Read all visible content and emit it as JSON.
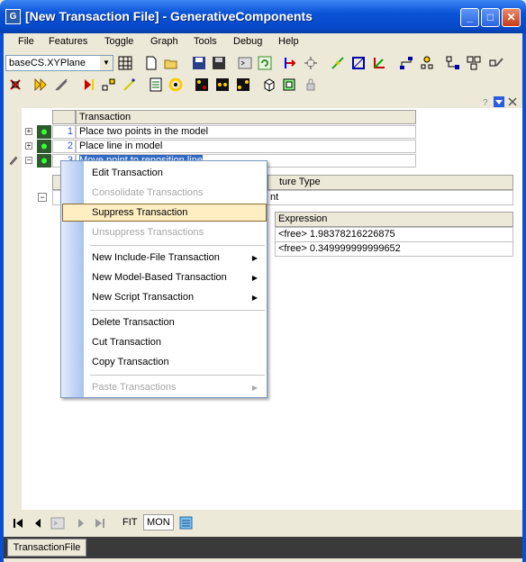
{
  "window": {
    "title": "[New Transaction File] - GenerativeComponents"
  },
  "menubar": [
    "File",
    "Features",
    "Toggle",
    "Graph",
    "Tools",
    "Debug",
    "Help"
  ],
  "toolbar": {
    "cs_select": "baseCS.XYPlane"
  },
  "transactions": {
    "header": "Transaction",
    "rows": [
      {
        "num": "1",
        "label": "Place two points in the model"
      },
      {
        "num": "2",
        "label": "Place line in model"
      },
      {
        "num": "3",
        "label": "Move point to reposition line"
      }
    ]
  },
  "subgrid": {
    "feature_type_header": "ture Type",
    "feature_type_value": "nt"
  },
  "expressions": {
    "header": "Expression",
    "rows": [
      "<free> 1.98378216226875",
      "<free> 0.349999999999652"
    ]
  },
  "context_menu": {
    "items": [
      {
        "label": "Edit Transaction",
        "enabled": true
      },
      {
        "label": "Consolidate Transactions",
        "enabled": false
      },
      {
        "label": "Suppress Transaction",
        "enabled": true,
        "highlighted": true
      },
      {
        "label": "Unsuppress Transactions",
        "enabled": false
      },
      {
        "label": "New Include-File Transaction",
        "enabled": true,
        "submenu": true
      },
      {
        "label": "New Model-Based Transaction",
        "enabled": true,
        "submenu": true
      },
      {
        "label": "New Script Transaction",
        "enabled": true,
        "submenu": true
      },
      {
        "label": "Delete Transaction",
        "enabled": true
      },
      {
        "label": "Cut Transaction",
        "enabled": true
      },
      {
        "label": "Copy Transaction",
        "enabled": true
      },
      {
        "label": "Paste Transactions",
        "enabled": false,
        "submenu": true
      }
    ]
  },
  "bottom_nav": {
    "fit": "FIT",
    "mon": "MON"
  },
  "status": {
    "tab": "TransactionFile"
  },
  "colors": {
    "titlebar": "#0548c8",
    "highlight": "#ffeec2",
    "status_bg": "#3a3a3a"
  }
}
